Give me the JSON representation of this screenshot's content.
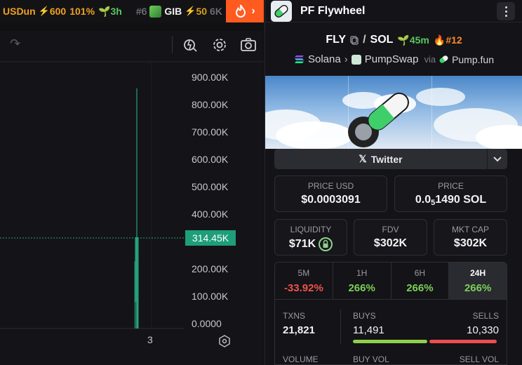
{
  "ticker": {
    "item1": {
      "symbol": "USDun",
      "boost": "600",
      "change": "101%",
      "age": "3h"
    },
    "item2": {
      "rank": "#6",
      "symbol": "GIB",
      "boost": "50",
      "more": "6K"
    }
  },
  "chart": {
    "price_axis": [
      "900.00K",
      "800.00K",
      "700.00K",
      "600.00K",
      "500.00K",
      "400.00K",
      "200.00K",
      "100.00K",
      "0.0000"
    ],
    "current_price": "314.45K",
    "time_tick": "3",
    "colors": {
      "up": "#26a17b",
      "badge": "#1e9e7a"
    }
  },
  "panel": {
    "title": "PF Flywheel",
    "pair": {
      "base": "FLY",
      "sep": "/",
      "quote": "SOL",
      "age": "45m",
      "rank": "#12"
    },
    "chain": {
      "network": "Solana",
      "dex": "PumpSwap",
      "via": "via",
      "launchpad": "Pump.fun"
    },
    "social": {
      "twitter": "Twitter"
    },
    "price_usd": {
      "label": "PRICE USD",
      "value": "$0.0003091"
    },
    "price_sol": {
      "label": "PRICE",
      "value_prefix": "0.0",
      "value_sub": "5",
      "value_rest": "1490 SOL"
    },
    "liquidity": {
      "label": "LIQUIDITY",
      "value": "$71K"
    },
    "fdv": {
      "label": "FDV",
      "value": "$302K"
    },
    "mcap": {
      "label": "MKT CAP",
      "value": "$302K"
    },
    "timeframes": [
      {
        "label": "5M",
        "value": "-33.92%",
        "color": "#f0524a"
      },
      {
        "label": "1H",
        "value": "266%",
        "color": "#7ccf58"
      },
      {
        "label": "6H",
        "value": "266%",
        "color": "#7ccf58"
      },
      {
        "label": "24H",
        "value": "266%",
        "color": "#7ccf58"
      }
    ],
    "txns": {
      "label": "TXNS",
      "value": "21,821"
    },
    "buys": {
      "label": "BUYS",
      "value": "11,491"
    },
    "sells": {
      "label": "SELLS",
      "value": "10,330"
    },
    "buy_ratio": 0.527,
    "volume": {
      "label": "VOLUME"
    },
    "buy_vol": {
      "label": "BUY VOL"
    },
    "sell_vol": {
      "label": "SELL VOL"
    }
  }
}
